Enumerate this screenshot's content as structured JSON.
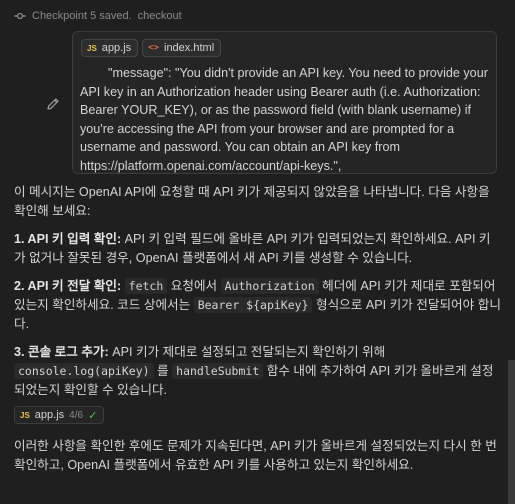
{
  "checkpoint": {
    "text": "Checkpoint 5 saved.",
    "link": "checkout"
  },
  "context_chips": [
    {
      "icon": "js-file-icon",
      "label": "app.js"
    },
    {
      "icon": "html-file-icon",
      "label": "index.html"
    }
  ],
  "user_message": "        \"message\": \"You didn't provide an API key. You need to provide your API key in an Authorization header using Bearer auth (i.e. Authorization: Bearer YOUR_KEY), or as the password field (with blank username) if you're accessing the API from your browser and are prompted for a username and password. You can obtain an API key from https://platform.openai.com/account/api-keys.\",",
  "reply": {
    "intro": "이 메시지는 OpenAI API에 요청할 때 API 키가 제공되지 않았음을 나타냅니다. 다음 사항을 확인해 보세요:",
    "item1": {
      "title": "1. API 키 입력 확인:",
      "text": " API 키 입력 필드에 올바른 API 키가 입력되었는지 확인하세요. API 키가 없거나 잘못된 경우, OpenAI 플랫폼에서 새 API 키를 생성할 수 있습니다."
    },
    "item2": {
      "title": "2. API 키 전달 확인:",
      "code1": "fetch",
      "text1": " 요청에서 ",
      "code2": "Authorization",
      "text2": " 헤더에 API 키가 제대로 포함되어 있는지 확인하세요. 코드 상에서는 ",
      "code3": "Bearer ${apiKey}",
      "text3": " 형식으로 API 키가 전달되어야 합니다."
    },
    "item3": {
      "title": "3. 콘솔 로그 추가:",
      "text1": " API 키가 제대로 설정되고 전달되는지 확인하기 위해 ",
      "code1": "console.log(apiKey)",
      "text2": " 를 ",
      "code2": "handleSubmit",
      "text3": " 함수 내에 추가하여 API 키가 올바르게 설정되었는지 확인할 수 있습니다."
    }
  },
  "file_chip": {
    "label": "app.js",
    "count": "4/6"
  },
  "outro": "이러한 사항을 확인한 후에도 문제가 지속된다면, API 키가 올바르게 설정되었는지 다시 한 번 확인하고, OpenAI 플랫폼에서 유효한 API 키를 사용하고 있는지 확인하세요.",
  "colors": {
    "background": "#1f1f1f",
    "text": "#d4d4d4",
    "muted": "#8b8b8b",
    "check": "#4ec94e",
    "js_badge": "#e8c44a",
    "html_badge": "#e06c47"
  }
}
